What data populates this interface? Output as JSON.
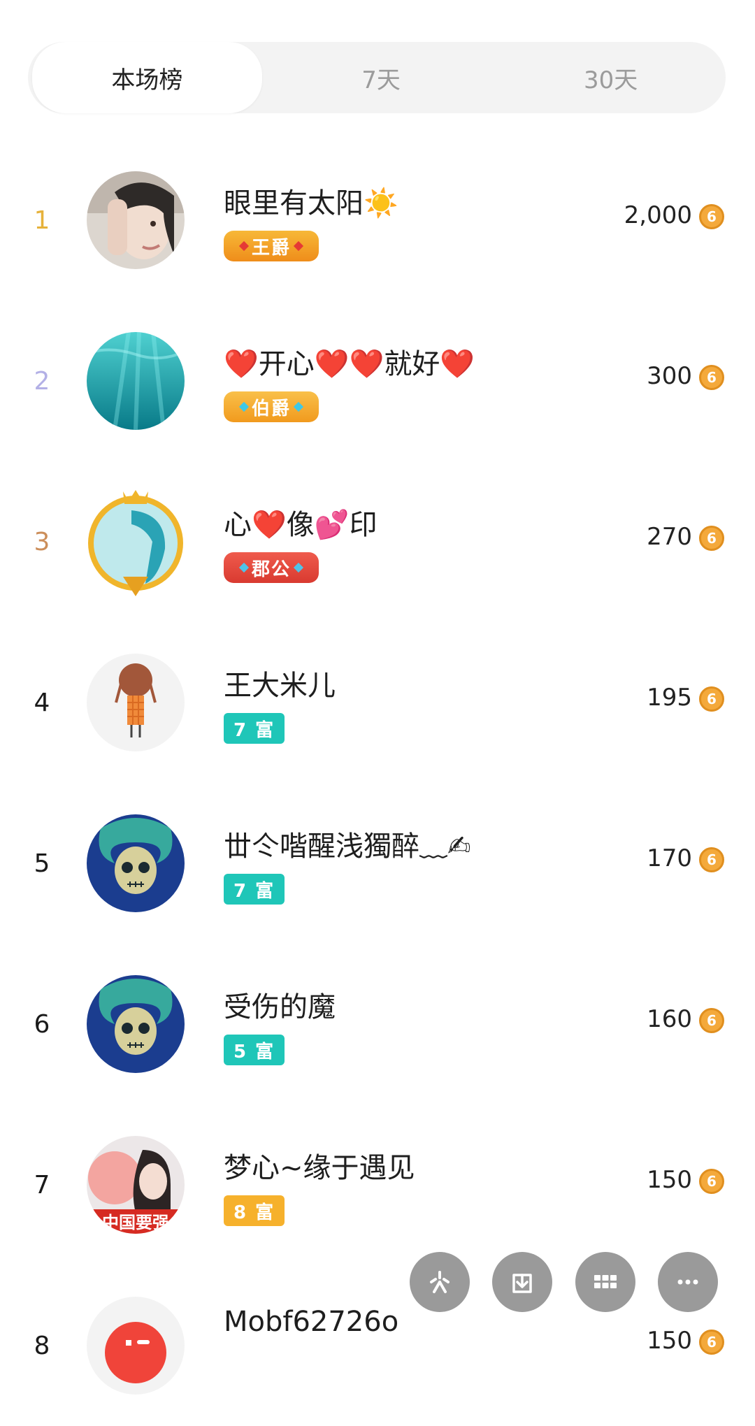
{
  "tabs": [
    {
      "label": "本场榜",
      "active": true
    },
    {
      "label": "7天",
      "active": false
    },
    {
      "label": "30天",
      "active": false
    }
  ],
  "ranking": [
    {
      "rank": "1",
      "name": "眼里有太阳☀️",
      "badge": "王爵",
      "badge_type": "noble-gold",
      "score": "2,000",
      "rank_color": "#e6b23b"
    },
    {
      "rank": "2",
      "name": "❤️开心❤️❤️就好❤️",
      "badge": "伯爵",
      "badge_type": "noble-orange",
      "score": "300",
      "rank_color": "#b3b0e6"
    },
    {
      "rank": "3",
      "name": "心❤️像💕印",
      "badge": "郡公",
      "badge_type": "noble-red",
      "score": "270",
      "rank_color": "#cc8e5a"
    },
    {
      "rank": "4",
      "name": "王大米儿",
      "badge": "7 富",
      "badge_type": "wealth-teal",
      "score": "195",
      "rank_color": "#222222"
    },
    {
      "rank": "5",
      "name": "丗仒喈醒浅獨醉﹏✍",
      "badge": "7 富",
      "badge_type": "wealth-teal",
      "score": "170",
      "rank_color": "#222222"
    },
    {
      "rank": "6",
      "name": "受伤的魔",
      "badge": "5 富",
      "badge_type": "wealth-teal",
      "score": "160",
      "rank_color": "#222222"
    },
    {
      "rank": "7",
      "name": "梦心~缘于遇见",
      "badge": "8 富",
      "badge_type": "wealth-orange",
      "score": "150",
      "rank_color": "#222222"
    },
    {
      "rank": "8",
      "name": "Mobf62726o",
      "badge": "",
      "badge_type": "",
      "score": "150",
      "rank_color": "#222222"
    }
  ],
  "avatar_7_text": "中国要强",
  "coin_glyph": "6",
  "fab_icons": [
    "spark-icon",
    "download-icon",
    "grid-icon",
    "more-icon"
  ],
  "colors": {
    "teal": "#1fc6b8",
    "orange": "#f6b12c",
    "gold": "#f3a321",
    "red": "#e8473d",
    "coin": "#f4a93b",
    "fab": "#9a9a9a"
  }
}
